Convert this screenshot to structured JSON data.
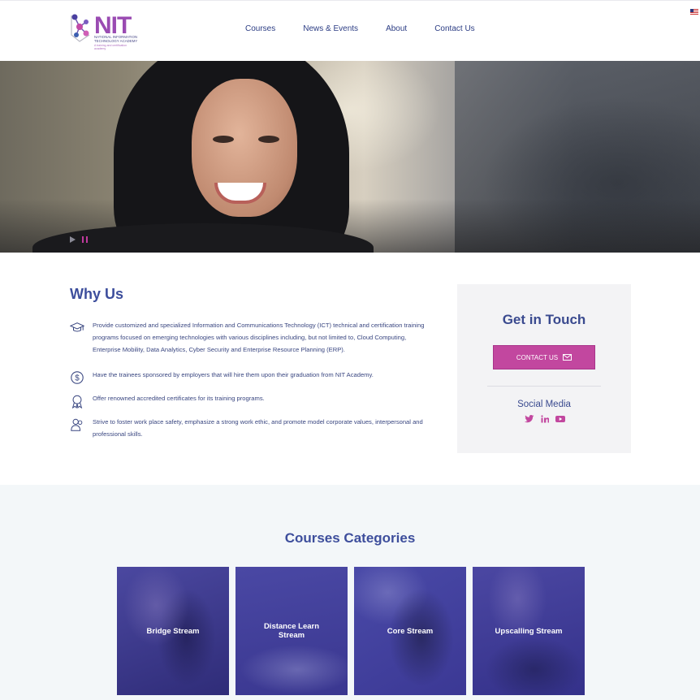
{
  "header": {
    "logo_word": "NIT",
    "logo_subtitle": "NATIONAL INFORMATION TECHNOLOGY ACADEMY",
    "logo_tagline": "A training and certification academy",
    "nav": [
      "Courses",
      "News & Events",
      "About",
      "Contact Us"
    ],
    "language_flag": "flag-us-icon"
  },
  "hero": {
    "slider_controls": [
      "play-icon",
      "pause-icon"
    ],
    "active_control": "pause"
  },
  "why_us": {
    "title": "Why Us",
    "items": [
      {
        "icon": "graduation-cap-icon",
        "text": "Provide customized and specialized Information and Communications Technology (ICT) technical and certification training programs focused on emerging technologies with various disciplines including, but not limited to, Cloud Computing, Enterprise Mobility, Data Analytics, Cyber Security and Enterprise Resource Planning (ERP)."
      },
      {
        "icon": "dollar-circle-icon",
        "text": "Have the trainees sponsored by employers that will hire them upon their graduation from NIT Academy."
      },
      {
        "icon": "award-ribbon-icon",
        "text": "Offer renowned accredited certificates for its training programs."
      },
      {
        "icon": "people-icon",
        "text": "Strive to foster work place safety, emphasize a strong work ethic, and promote model corporate values, interpersonal and professional skills."
      }
    ]
  },
  "get_in_touch": {
    "title": "Get in Touch",
    "button": "CONTACT US",
    "social_title": "Social Media",
    "social": [
      "twitter-icon",
      "linkedin-icon",
      "youtube-icon"
    ]
  },
  "courses": {
    "title": "Courses Categories",
    "tiles": [
      "Bridge Stream",
      "Distance Learn Stream",
      "Core Stream",
      "Upscalling Stream"
    ]
  },
  "colors": {
    "brand_purple": "#9a4bb2",
    "accent_magenta": "#c2479f",
    "heading_blue": "#3d4e9c",
    "tile_overlay": "#3d3a8e"
  }
}
